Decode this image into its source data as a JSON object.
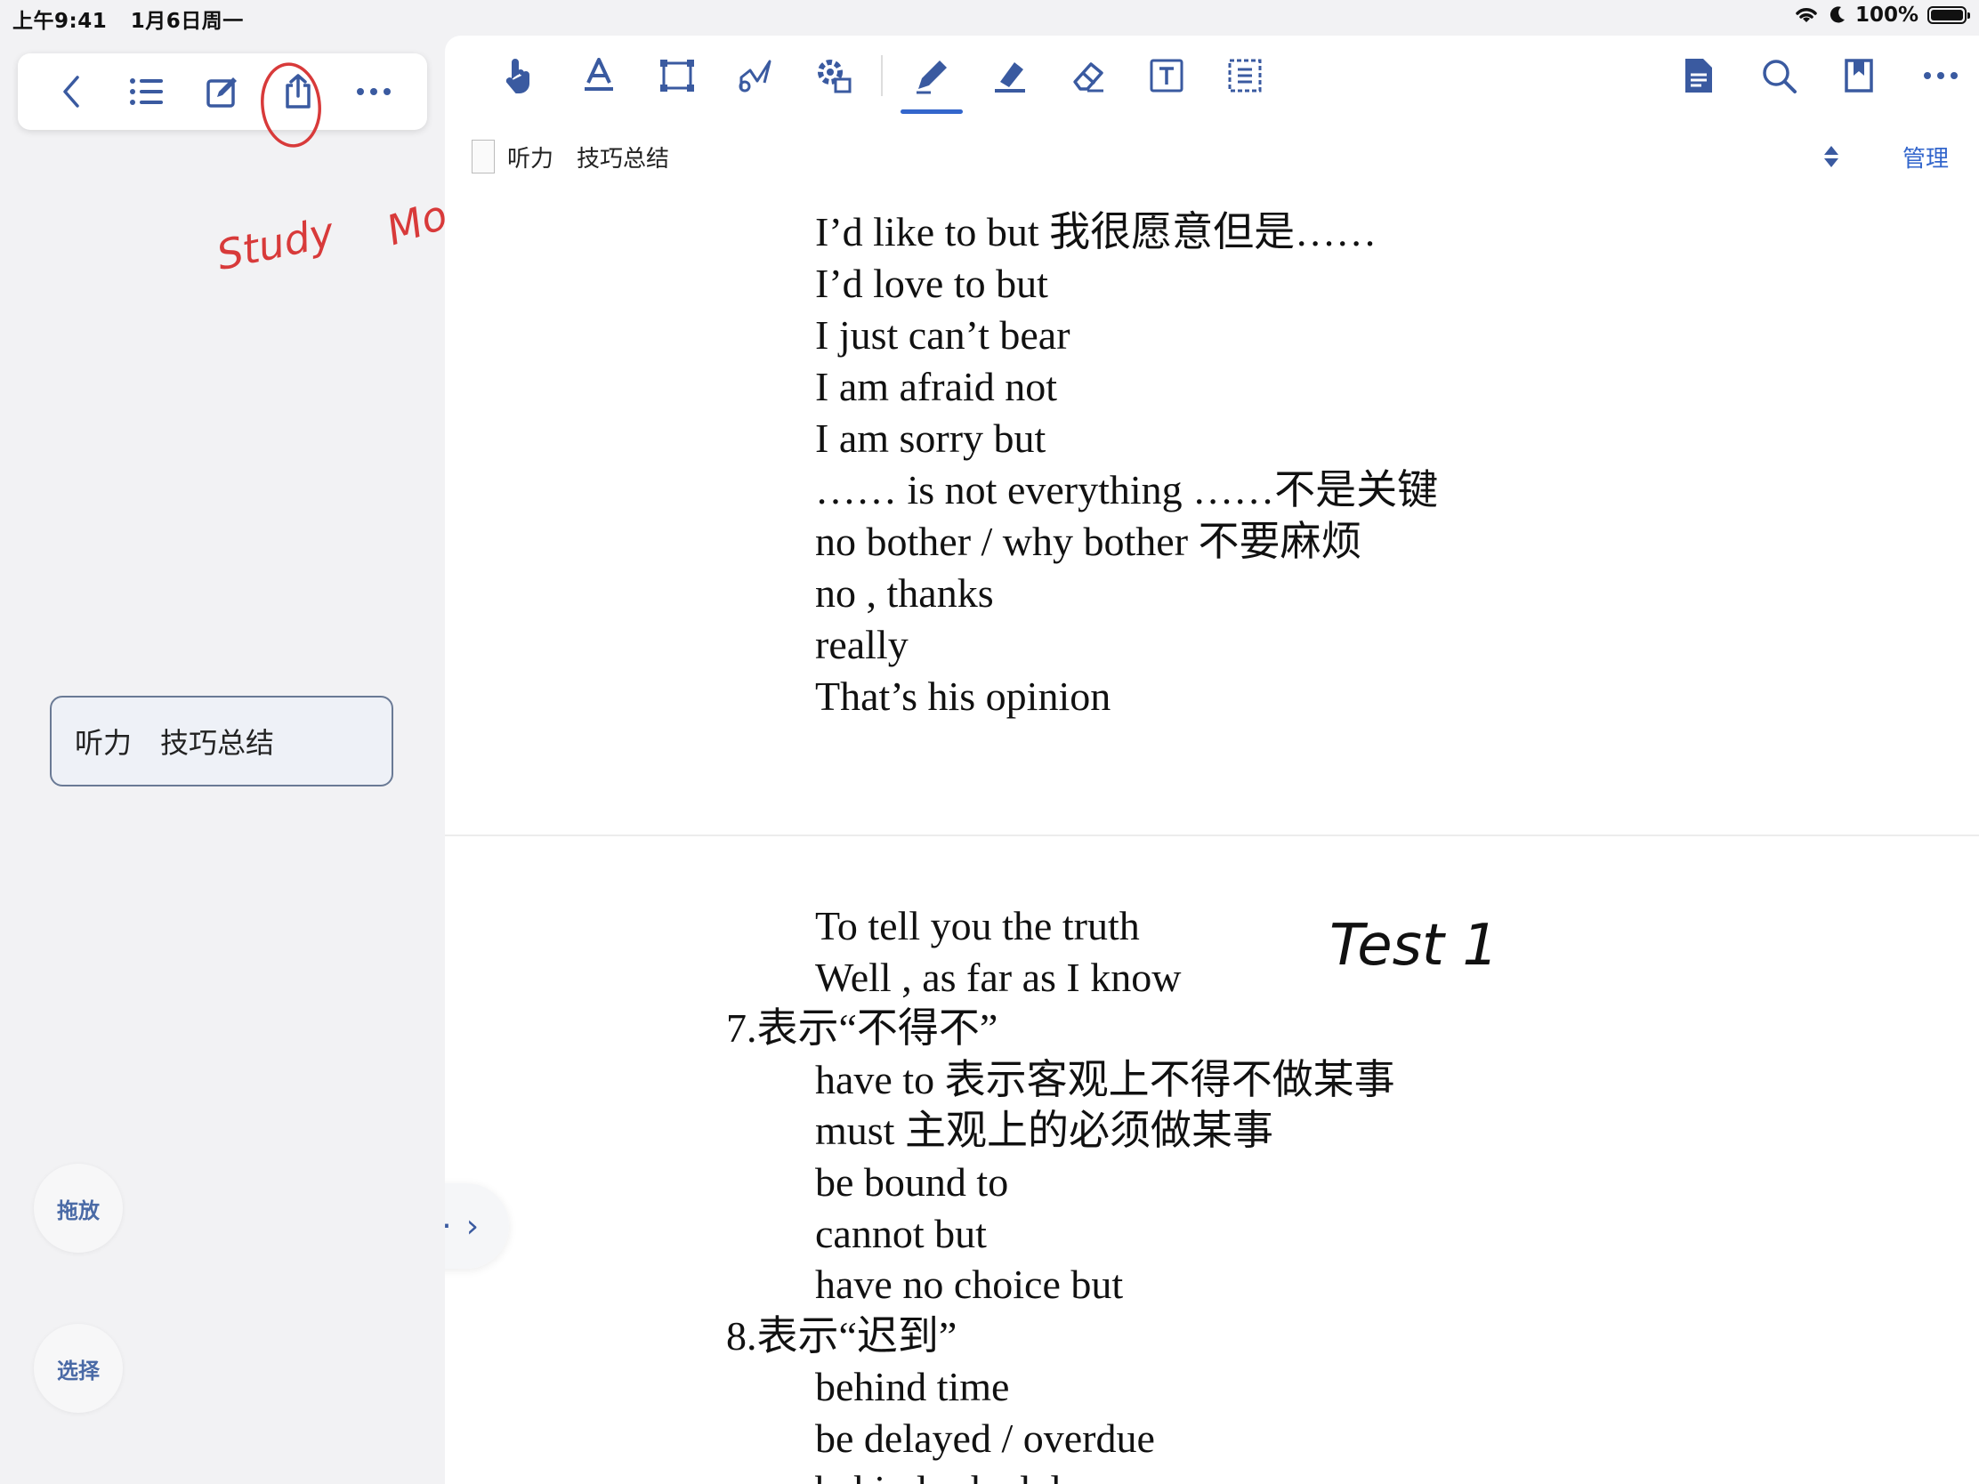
{
  "status": {
    "time": "上午9:41",
    "date": "1月6日周一",
    "battery": "100%"
  },
  "left_toolbar": {
    "back": "back-icon",
    "list": "list-icon",
    "edit": "edit-icon",
    "share": "share-icon",
    "more": "more-icon"
  },
  "annotations": {
    "study": "Study",
    "mode": "Mode",
    "test": "Test 1"
  },
  "sidebar": {
    "doc_title": "听力　技巧总结",
    "drag_label": "拖放",
    "select_label": "选择"
  },
  "main_toolbar": {
    "tools": [
      "hand-icon",
      "text-icon",
      "select-rect-icon",
      "lasso-icon",
      "settings-icon",
      "pen-icon",
      "highlighter-icon",
      "eraser-icon",
      "textbox-icon",
      "scan-icon"
    ],
    "right_tools": [
      "document-icon",
      "search-icon",
      "bookmark-icon",
      "more-icon"
    ],
    "active_tool": "pen-icon"
  },
  "tab": {
    "title": "听力　技巧总结",
    "manage_label": "管理"
  },
  "document": {
    "page1_lines": [
      "I’d like to but 我很愿意但是……",
      "I’d love to but",
      "I just can’t bear",
      "I am afraid not",
      "I am sorry but",
      "…… is not everything ……不是关键",
      "no bother / why bother 不要麻烦",
      "no , thanks",
      "really",
      "That’s his opinion"
    ],
    "page2_lines": [
      {
        "text": "To tell you the truth",
        "indent": true
      },
      {
        "text": "Well , as far as I know",
        "indent": true
      },
      {
        "text": "7.表示“不得不”",
        "indent": false
      },
      {
        "text": "have to 表示客观上不得不做某事",
        "indent": true
      },
      {
        "text": "must 主观上的必须做某事",
        "indent": true
      },
      {
        "text": "be bound to",
        "indent": true
      },
      {
        "text": "cannot but",
        "indent": true
      },
      {
        "text": "have no choice but",
        "indent": true
      },
      {
        "text": "8.表示“迟到”",
        "indent": false
      },
      {
        "text": "behind time",
        "indent": true
      },
      {
        "text": "be delayed / overdue",
        "indent": true
      },
      {
        "text": "behind schedule",
        "indent": true
      }
    ]
  },
  "pager": {
    "prev": "‹",
    "dot": "·",
    "next": "›"
  }
}
